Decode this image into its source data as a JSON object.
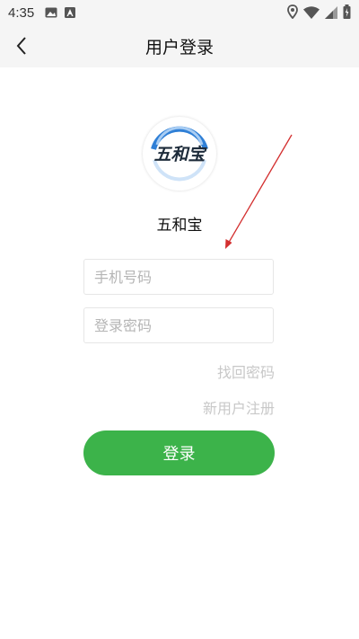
{
  "status_bar": {
    "time": "4:35",
    "icons": [
      "image-icon",
      "a-letter-icon",
      "location-icon",
      "wifi-icon",
      "signal-icon",
      "battery-icon"
    ]
  },
  "header": {
    "title": "用户登录",
    "back_icon": "chevron-left-icon"
  },
  "app": {
    "logo_text": "五和宝",
    "name": "五和宝"
  },
  "form": {
    "phone_placeholder": "手机号码",
    "password_placeholder": "登录密码",
    "forgot_password": "找回密码",
    "new_user_register": "新用户注册",
    "login_button": "登录"
  },
  "colors": {
    "primary_green": "#3cb34a",
    "logo_blue": "#2f7fd6",
    "annotation_red": "#d32f2f"
  }
}
